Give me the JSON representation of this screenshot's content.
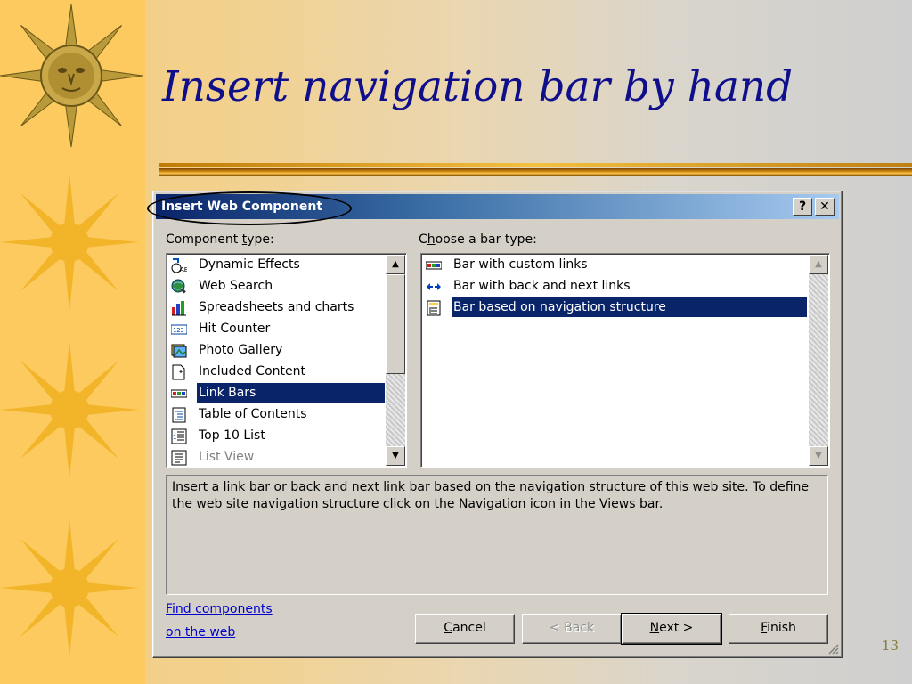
{
  "slide": {
    "title": "Insert navigation bar by hand",
    "page_number": "13"
  },
  "dialog": {
    "title": "Insert Web Component",
    "help_label": "?",
    "close_label": "✕",
    "component_type_label_pre": "Component ",
    "component_type_label_key": "t",
    "component_type_label_post": "ype:",
    "bar_type_label_pre": "C",
    "bar_type_label_key": "h",
    "bar_type_label_post": "oose a bar type:",
    "components": [
      {
        "label": "Dynamic Effects",
        "icon": "dynamic-effects-icon"
      },
      {
        "label": "Web Search",
        "icon": "web-search-icon"
      },
      {
        "label": "Spreadsheets and charts",
        "icon": "spreadsheet-icon"
      },
      {
        "label": "Hit Counter",
        "icon": "hit-counter-icon"
      },
      {
        "label": "Photo Gallery",
        "icon": "photo-gallery-icon"
      },
      {
        "label": "Included Content",
        "icon": "included-content-icon"
      },
      {
        "label": "Link Bars",
        "icon": "link-bar-icon"
      },
      {
        "label": "Table of Contents",
        "icon": "table-of-contents-icon"
      },
      {
        "label": "Top 10 List",
        "icon": "top-10-list-icon"
      },
      {
        "label": "List View",
        "icon": "list-view-icon"
      }
    ],
    "bar_types": [
      {
        "label": "Bar with custom links",
        "icon": "link-bar-icon"
      },
      {
        "label": "Bar with back and next links",
        "icon": "back-next-arrows-icon"
      },
      {
        "label": "Bar based on navigation structure",
        "icon": "navigation-structure-icon"
      }
    ],
    "selected_component": "Link Bars",
    "selected_bar_type": "Bar based on navigation structure",
    "description": "Insert a link bar or back and next link bar based on the navigation structure of this web site.  To define the web site navigation structure click on the Navigation icon in the Views bar.",
    "find_link_line1": "Find components",
    "find_link_line2": "on the web",
    "buttons": {
      "cancel_key": "C",
      "cancel_rest": "ancel",
      "back": "< Back",
      "next_key": "N",
      "next_rest": "ext >",
      "finish_key": "F",
      "finish_rest": "inish"
    }
  },
  "colors": {
    "left_strip": "#fcca5e",
    "title_text": "#0f0f8c",
    "selection": "#0a246a",
    "dialog_face": "#d4d0c8"
  }
}
